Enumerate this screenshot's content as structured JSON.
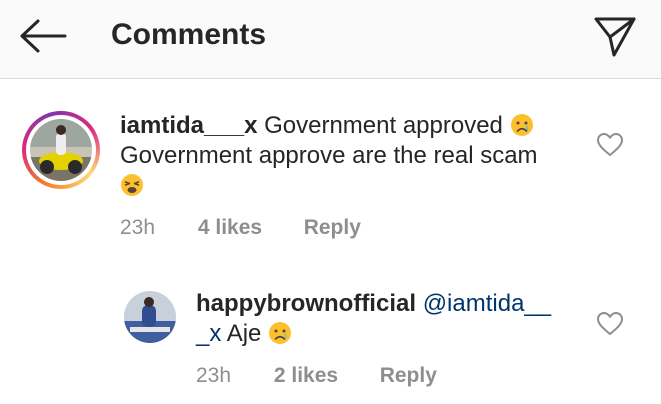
{
  "header": {
    "title": "Comments"
  },
  "comments": [
    {
      "username": "iamtida___x",
      "text_line1": "Government approved",
      "text_line2": "Government approve are the real scam",
      "emoji1": "crying-face",
      "emoji2": "weary-face",
      "time": "23h",
      "likes": "4 likes",
      "reply": "Reply"
    },
    {
      "username": "happybrownofficial",
      "mention_part1": "@iamtida__",
      "mention_part2": "_x",
      "text": "Aje",
      "emoji": "crying-face",
      "time": "23h",
      "likes": "2 likes",
      "reply": "Reply"
    }
  ],
  "icons": {
    "back": "arrow-left-icon",
    "direct": "paper-plane-icon",
    "like": "heart-outline-icon"
  },
  "colors": {
    "text": "#262626",
    "muted": "#8e8e8e",
    "mention": "#003569",
    "header_bg": "#fafafa"
  }
}
